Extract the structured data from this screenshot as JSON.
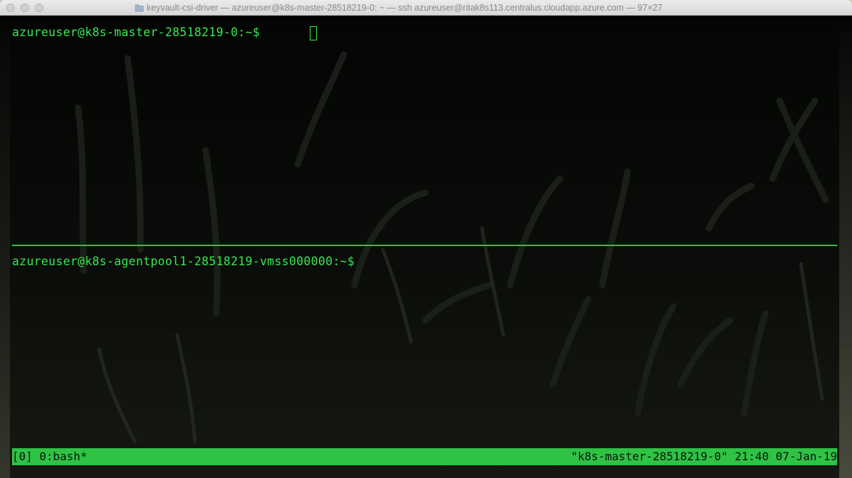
{
  "window": {
    "title": "keyvault-csi-driver — azureuser@k8s-master-28518219-0: ~ — ssh azureuser@ritak8s113.centralus.cloudapp.azure.com — 97×27"
  },
  "panes": {
    "top": {
      "prompt": "azureuser@k8s-master-28518219-0:~$ "
    },
    "bottom": {
      "prompt": "azureuser@k8s-agentpool1-28518219-vmss000000:~$ "
    }
  },
  "statusbar": {
    "left": "[0] 0:bash*",
    "right": "\"k8s-master-28518219-0\" 21:40 07-Jan-19"
  },
  "colors": {
    "terminal_text": "#35e84f",
    "status_bg": "#2fc245",
    "background": "#050605"
  },
  "icons": {
    "title_icon": "folder-icon"
  }
}
